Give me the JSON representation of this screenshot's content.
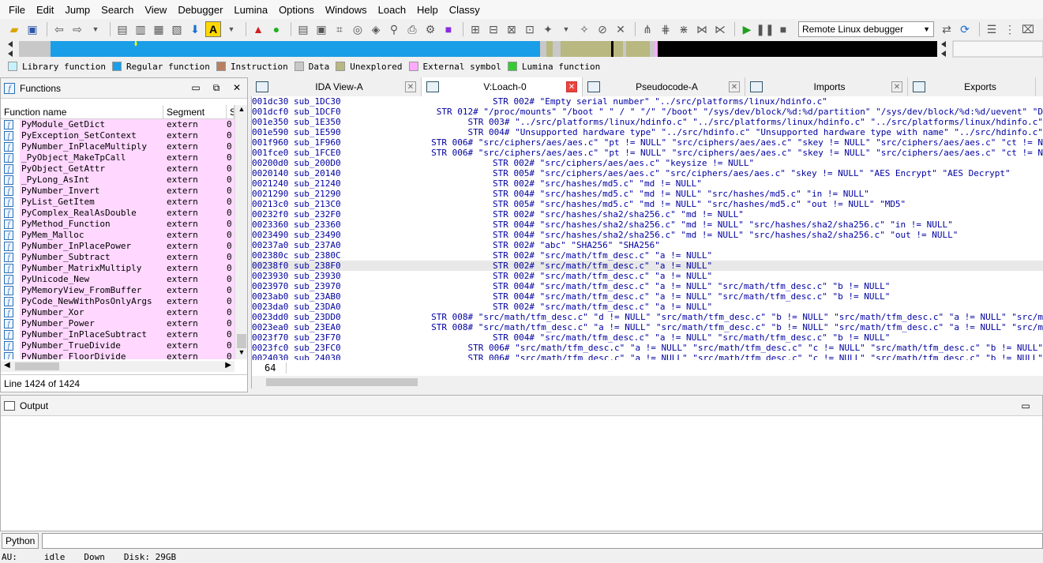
{
  "menu": [
    "File",
    "Edit",
    "Jump",
    "Search",
    "View",
    "Debugger",
    "Lumina",
    "Options",
    "Windows",
    "Loach",
    "Help",
    "Classy"
  ],
  "toolbar": {
    "debugger_select": "Remote Linux debugger"
  },
  "legend": [
    {
      "label": "Library function",
      "color": "#c6f2ff"
    },
    {
      "label": "Regular function",
      "color": "#1a9ee8"
    },
    {
      "label": "Instruction",
      "color": "#b88060"
    },
    {
      "label": "Data",
      "color": "#c8c8c8"
    },
    {
      "label": "Unexplored",
      "color": "#b8b880"
    },
    {
      "label": "External symbol",
      "color": "#ffaaff"
    },
    {
      "label": "Lumina function",
      "color": "#33cc33"
    }
  ],
  "functions_pane": {
    "title": "Functions",
    "columns": [
      "Function name",
      "Segment",
      "S"
    ],
    "rows": [
      {
        "name": "PyModule_GetDict",
        "segment": "extern",
        "s": "0"
      },
      {
        "name": "PyException_SetContext",
        "segment": "extern",
        "s": "0"
      },
      {
        "name": "PyNumber_InPlaceMultiply",
        "segment": "extern",
        "s": "0"
      },
      {
        "name": "_PyObject_MakeTpCall",
        "segment": "extern",
        "s": "0"
      },
      {
        "name": "PyObject_GetAttr",
        "segment": "extern",
        "s": "0"
      },
      {
        "name": "_PyLong_AsInt",
        "segment": "extern",
        "s": "0"
      },
      {
        "name": "PyNumber_Invert",
        "segment": "extern",
        "s": "0"
      },
      {
        "name": "PyList_GetItem",
        "segment": "extern",
        "s": "0"
      },
      {
        "name": "PyComplex_RealAsDouble",
        "segment": "extern",
        "s": "0"
      },
      {
        "name": "PyMethod_Function",
        "segment": "extern",
        "s": "0"
      },
      {
        "name": "PyMem_Malloc",
        "segment": "extern",
        "s": "0"
      },
      {
        "name": "PyNumber_InPlacePower",
        "segment": "extern",
        "s": "0"
      },
      {
        "name": "PyNumber_Subtract",
        "segment": "extern",
        "s": "0"
      },
      {
        "name": "PyNumber_MatrixMultiply",
        "segment": "extern",
        "s": "0"
      },
      {
        "name": "PyUnicode_New",
        "segment": "extern",
        "s": "0"
      },
      {
        "name": "PyMemoryView_FromBuffer",
        "segment": "extern",
        "s": "0"
      },
      {
        "name": "PyCode_NewWithPosOnlyArgs",
        "segment": "extern",
        "s": "0"
      },
      {
        "name": "PyNumber_Xor",
        "segment": "extern",
        "s": "0"
      },
      {
        "name": "PyNumber_Power",
        "segment": "extern",
        "s": "0"
      },
      {
        "name": "PyNumber_InPlaceSubtract",
        "segment": "extern",
        "s": "0"
      },
      {
        "name": "PyNumber_TrueDivide",
        "segment": "extern",
        "s": "0"
      },
      {
        "name": "PyNumber_FloorDivide",
        "segment": "extern",
        "s": "0"
      }
    ],
    "status": "Line 1424 of 1424"
  },
  "tabs": [
    {
      "label": "IDA View-A",
      "active": false
    },
    {
      "label": "V:Loach-0",
      "active": true
    },
    {
      "label": "Pseudocode-A",
      "active": false
    },
    {
      "label": "Imports",
      "active": false
    },
    {
      "label": "Exports",
      "active": false
    }
  ],
  "listing": [
    {
      "addr": "001dc30 sub_1DC30",
      "text": "STR 002# \"Empty serial number\" \"../src/platforms/linux/hdinfo.c\""
    },
    {
      "addr": "001dcf0 sub_1DCF0",
      "text": "STR 012# \"/proc/mounts\" \"/boot \" \" / \" \"/\" \"/boot\" \"/sys/dev/block/%d:%d/partition\" \"/sys/dev/block/%d:%d/uevent\" \"D"
    },
    {
      "addr": "001e350 sub_1E350",
      "text": "STR 003# \"../src/platforms/linux/hdinfo.c\" \"../src/platforms/linux/hdinfo.c\" \"../src/platforms/linux/hdinfo.c\""
    },
    {
      "addr": "001e590 sub_1E590",
      "text": "STR 004# \"Unsupported hardware type\" \"../src/hdinfo.c\" \"Unsupported hardware type with name\" \"../src/hdinfo.c\""
    },
    {
      "addr": "001f960 sub_1F960",
      "text": "STR 006# \"src/ciphers/aes/aes.c\" \"pt != NULL\" \"src/ciphers/aes/aes.c\" \"skey != NULL\" \"src/ciphers/aes/aes.c\" \"ct != N"
    },
    {
      "addr": "001fce0 sub_1FCE0",
      "text": "STR 006# \"src/ciphers/aes/aes.c\" \"pt != NULL\" \"src/ciphers/aes/aes.c\" \"skey != NULL\" \"src/ciphers/aes/aes.c\" \"ct != N"
    },
    {
      "addr": "00200d0 sub_200D0",
      "text": "STR 002# \"src/ciphers/aes/aes.c\" \"keysize != NULL\""
    },
    {
      "addr": "0020140 sub_20140",
      "text": "STR 005# \"src/ciphers/aes/aes.c\" \"src/ciphers/aes/aes.c\" \"skey != NULL\" \"AES Encrypt\" \"AES Decrypt\""
    },
    {
      "addr": "0021240 sub_21240",
      "text": "STR 002# \"src/hashes/md5.c\" \"md != NULL\""
    },
    {
      "addr": "0021290 sub_21290",
      "text": "STR 004# \"src/hashes/md5.c\" \"md != NULL\" \"src/hashes/md5.c\" \"in != NULL\""
    },
    {
      "addr": "00213c0 sub_213C0",
      "text": "STR 005# \"src/hashes/md5.c\" \"md != NULL\" \"src/hashes/md5.c\" \"out != NULL\" \"MD5\""
    },
    {
      "addr": "00232f0 sub_232F0",
      "text": "STR 002# \"src/hashes/sha2/sha256.c\" \"md != NULL\""
    },
    {
      "addr": "0023360 sub_23360",
      "text": "STR 004# \"src/hashes/sha2/sha256.c\" \"md != NULL\" \"src/hashes/sha2/sha256.c\" \"in != NULL\""
    },
    {
      "addr": "0023490 sub_23490",
      "text": "STR 004# \"src/hashes/sha2/sha256.c\" \"md != NULL\" \"src/hashes/sha2/sha256.c\" \"out != NULL\""
    },
    {
      "addr": "00237a0 sub_237A0",
      "text": "STR 002# \"abc\" \"SHA256\" \"SHA256\""
    },
    {
      "addr": "002380c sub_2380C",
      "text": "STR 002# \"src/math/tfm_desc.c\" \"a != NULL\""
    },
    {
      "addr": "00238f0 sub_238F0",
      "text": "STR 002# \"src/math/tfm_desc.c\" \"a != NULL\"",
      "current": true
    },
    {
      "addr": "0023930 sub_23930",
      "text": "STR 002# \"src/math/tfm_desc.c\" \"a != NULL\""
    },
    {
      "addr": "0023970 sub_23970",
      "text": "STR 004# \"src/math/tfm_desc.c\" \"a != NULL\" \"src/math/tfm_desc.c\" \"b != NULL\""
    },
    {
      "addr": "0023ab0 sub_23AB0",
      "text": "STR 004# \"src/math/tfm_desc.c\" \"a != NULL\" \"src/math/tfm_desc.c\" \"b != NULL\""
    },
    {
      "addr": "0023da0 sub_23DA0",
      "text": "STR 002# \"src/math/tfm_desc.c\" \"a != NULL\""
    },
    {
      "addr": "0023dd0 sub_23DD0",
      "text": "STR 008# \"src/math/tfm_desc.c\" \"d != NULL\" \"src/math/tfm_desc.c\" \"b != NULL\" \"src/math/tfm_desc.c\" \"a != NULL\" \"src/m"
    },
    {
      "addr": "0023ea0 sub_23EA0",
      "text": "STR 008# \"src/math/tfm_desc.c\" \"a != NULL\" \"src/math/tfm_desc.c\" \"b != NULL\" \"src/math/tfm_desc.c\" \"a != NULL\" \"src/m"
    },
    {
      "addr": "0023f70 sub_23F70",
      "text": "STR 004# \"src/math/tfm_desc.c\" \"a != NULL\" \"src/math/tfm_desc.c\" \"b != NULL\""
    },
    {
      "addr": "0023fc0 sub_23FC0",
      "text": "STR 006# \"src/math/tfm_desc.c\" \"a != NULL\" \"src/math/tfm_desc.c\" \"c != NULL\" \"src/math/tfm_desc.c\" \"b != NULL\""
    },
    {
      "addr": "0024030 sub_24030",
      "text": "STR 006# \"src/math/tfm_desc.c\" \"a != NULL\" \"src/math/tfm_desc.c\" \"c != NULL\" \"src/math/tfm_desc.c\" \"b != NULL\""
    }
  ],
  "listing_footer": "64",
  "output_pane": {
    "title": "Output"
  },
  "python_button": "Python",
  "statusbar": {
    "au": "AU:",
    "state": "idle",
    "direction": "Down",
    "disk": "Disk: 29GB"
  }
}
